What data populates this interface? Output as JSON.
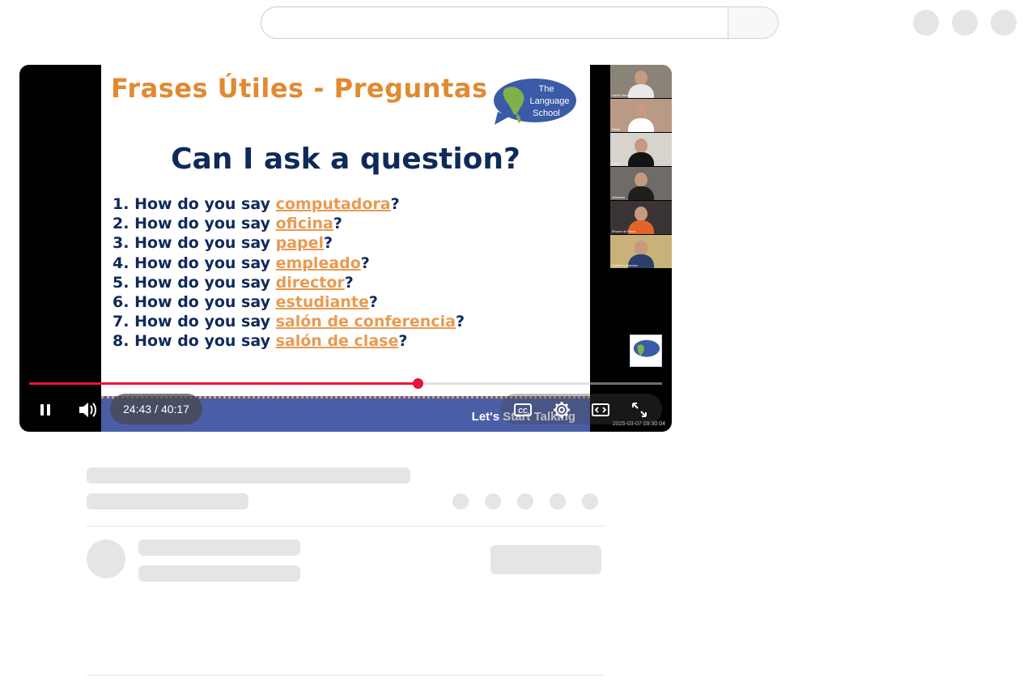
{
  "slide": {
    "title": "Frases Útiles - Preguntas",
    "logo_text": [
      "The",
      "Language",
      "School"
    ],
    "question": "Can I ask a question?",
    "items": [
      {
        "num": "1.",
        "prefix": "How do you say ",
        "word": "computadora",
        "suffix": "?"
      },
      {
        "num": "2.",
        "prefix": "How do you say ",
        "word": "oficina",
        "suffix": "?"
      },
      {
        "num": "3.",
        "prefix": "How do you say ",
        "word": "papel",
        "suffix": "?"
      },
      {
        "num": "4.",
        "prefix": "How do you say ",
        "word": "empleado",
        "suffix": "?"
      },
      {
        "num": "5.",
        "prefix": "How do you say ",
        "word": "director",
        "suffix": "?"
      },
      {
        "num": "6.",
        "prefix": "How do you say ",
        "word": "estudiante",
        "suffix": "?"
      },
      {
        "num": "7.",
        "prefix": "How do you say ",
        "word": "salón de conferencia",
        "suffix": "?"
      },
      {
        "num": "8.",
        "prefix": "How do you say ",
        "word": "salón de clase",
        "suffix": "?"
      }
    ],
    "footer_text": "Let's Start Talking",
    "title_color": "#e08a32",
    "text_color": "#0f2a5a",
    "highlight_color": "#e89a52",
    "footer_color": "#4a5ea8"
  },
  "participants": [
    {
      "name": "David Stevens",
      "bg": "#8a8378",
      "shirt": "#e8e8e8"
    },
    {
      "name": "Paula",
      "bg": "#b99a86",
      "shirt": "#ffffff"
    },
    {
      "name": "Dalia",
      "bg": "#d8d3cc",
      "shirt": "#141414"
    },
    {
      "name": "Abraham",
      "bg": "#6f6b66",
      "shirt": "#1f1f1f"
    },
    {
      "name": "iPhone de Paola",
      "bg": "#3a3534",
      "shirt": "#e0652a"
    },
    {
      "name": "Guillermo Romero",
      "bg": "#c8b27a",
      "shirt": "#2a3f6a"
    }
  ],
  "player": {
    "current_time": "24:43",
    "time_separator": "/",
    "duration": "40:17",
    "progress": 0.614,
    "recording_timestamp": "2025-03-07 09:30:04",
    "progress_color": "#f00f3c"
  },
  "icons": {
    "pause": "pause-icon",
    "volume": "volume-icon",
    "captions": "cc-icon",
    "settings": "gear-icon",
    "theater": "theater-mode-icon",
    "fullscreen": "fullscreen-icon"
  }
}
